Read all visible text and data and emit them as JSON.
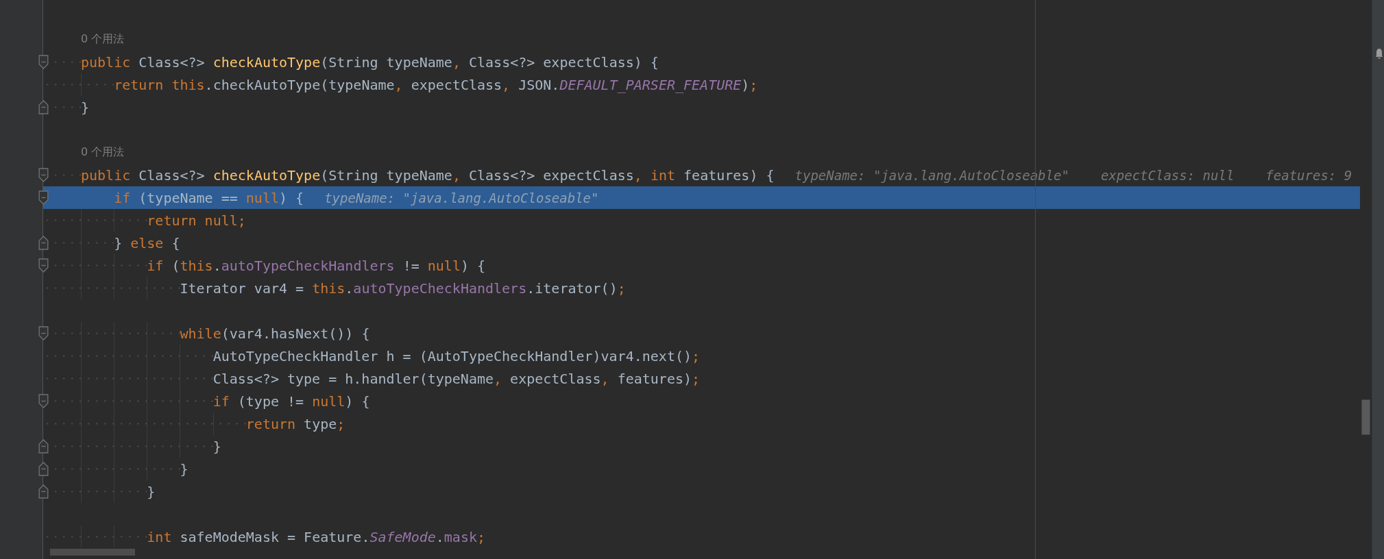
{
  "editor": {
    "lines": [
      {
        "kind": "usage",
        "text": "0 个用法"
      },
      {
        "kind": "code",
        "fold_start": true,
        "selected": false,
        "tokens": [
          {
            "text": "public",
            "kind": "kw"
          },
          {
            "text": " Class<?> ",
            "kind": "plain"
          },
          {
            "text": "checkAutoType",
            "kind": "decl"
          },
          {
            "text": "(String typeName",
            "kind": "plain"
          },
          {
            "text": ",",
            "kind": "punct"
          },
          {
            "text": " Class<?> expectClass) {",
            "kind": "plain"
          }
        ],
        "children": [
          {
            "kind": "code",
            "selected": false,
            "tokens": [
              {
                "text": "return this",
                "kind": "kw"
              },
              {
                "text": ".checkAutoType(typeName",
                "kind": "plain"
              },
              {
                "text": ",",
                "kind": "punct"
              },
              {
                "text": " expectClass",
                "kind": "plain"
              },
              {
                "text": ",",
                "kind": "punct"
              },
              {
                "text": " JSON.",
                "kind": "plain"
              },
              {
                "text": "DEFAULT_PARSER_FEATURE",
                "kind": "static"
              },
              {
                "text": ")",
                "kind": "plain"
              },
              {
                "text": ";",
                "kind": "punct"
              }
            ]
          }
        ]
      },
      {
        "kind": "code",
        "fold_end": true,
        "selected": false,
        "tokens": [
          {
            "text": "}",
            "kind": "plain"
          }
        ]
      },
      {
        "kind": "blank"
      },
      {
        "kind": "usage",
        "text": "0 个用法"
      },
      {
        "kind": "code",
        "fold_start": true,
        "selected": false,
        "tokens": [
          {
            "text": "public",
            "kind": "kw"
          },
          {
            "text": " Class<?> ",
            "kind": "plain"
          },
          {
            "text": "checkAutoType",
            "kind": "decl"
          },
          {
            "text": "(String typeName",
            "kind": "plain"
          },
          {
            "text": ",",
            "kind": "punct"
          },
          {
            "text": " Class<?> expectClass",
            "kind": "plain"
          },
          {
            "text": ",",
            "kind": "punct"
          },
          {
            "text": " int",
            "kind": "kw"
          },
          {
            "text": " features) {",
            "kind": "plain"
          }
        ],
        "hints": [
          "typeName: \"java.lang.AutoCloseable\"",
          "expectClass: null",
          "features: 9"
        ],
        "children": [
          {
            "kind": "code",
            "fold_start": true,
            "selected": true,
            "tokens": [
              {
                "text": "if",
                "kind": "kw"
              },
              {
                "text": " (typeName == ",
                "kind": "plain"
              },
              {
                "text": "null",
                "kind": "kw"
              },
              {
                "text": ") {",
                "kind": "plain"
              }
            ],
            "hints": [
              "typeName: \"java.lang.AutoCloseable\""
            ],
            "children": [
              {
                "kind": "code",
                "selected": false,
                "tokens": [
                  {
                    "text": "return null",
                    "kind": "kw"
                  },
                  {
                    "text": ";",
                    "kind": "punct"
                  }
                ]
              }
            ]
          },
          {
            "kind": "code",
            "fold_end": true,
            "selected": false,
            "tokens": [
              {
                "text": "} ",
                "kind": "plain"
              },
              {
                "text": "else",
                "kind": "kw"
              },
              {
                "text": " {",
                "kind": "plain"
              }
            ],
            "children": [
              {
                "kind": "code",
                "fold_start": true,
                "selected": false,
                "tokens": [
                  {
                    "text": "if",
                    "kind": "kw"
                  },
                  {
                    "text": " (",
                    "kind": "plain"
                  },
                  {
                    "text": "this",
                    "kind": "kw"
                  },
                  {
                    "text": ".",
                    "kind": "plain"
                  },
                  {
                    "text": "autoTypeCheckHandlers",
                    "kind": "field"
                  },
                  {
                    "text": " != ",
                    "kind": "plain"
                  },
                  {
                    "text": "null",
                    "kind": "kw"
                  },
                  {
                    "text": ") {",
                    "kind": "plain"
                  }
                ],
                "children": [
                  {
                    "kind": "code",
                    "selected": false,
                    "tokens": [
                      {
                        "text": "Iterator var4 = ",
                        "kind": "plain"
                      },
                      {
                        "text": "this",
                        "kind": "kw"
                      },
                      {
                        "text": ".",
                        "kind": "plain"
                      },
                      {
                        "text": "autoTypeCheckHandlers",
                        "kind": "field"
                      },
                      {
                        "text": ".iterator()",
                        "kind": "plain"
                      },
                      {
                        "text": ";",
                        "kind": "punct"
                      }
                    ]
                  },
                  {
                    "kind": "blank"
                  },
                  {
                    "kind": "code",
                    "fold_start": true,
                    "selected": false,
                    "tokens": [
                      {
                        "text": "while",
                        "kind": "kw"
                      },
                      {
                        "text": "(var4.hasNext()) {",
                        "kind": "plain"
                      }
                    ],
                    "children": [
                      {
                        "kind": "code",
                        "selected": false,
                        "tokens": [
                          {
                            "text": "AutoTypeCheckHandler h = (AutoTypeCheckHandler)var4.next()",
                            "kind": "plain"
                          },
                          {
                            "text": ";",
                            "kind": "punct"
                          }
                        ]
                      },
                      {
                        "kind": "code",
                        "selected": false,
                        "tokens": [
                          {
                            "text": "Class<?> type = h.handler(typeName",
                            "kind": "plain"
                          },
                          {
                            "text": ",",
                            "kind": "punct"
                          },
                          {
                            "text": " expectClass",
                            "kind": "plain"
                          },
                          {
                            "text": ",",
                            "kind": "punct"
                          },
                          {
                            "text": " features)",
                            "kind": "plain"
                          },
                          {
                            "text": ";",
                            "kind": "punct"
                          }
                        ]
                      },
                      {
                        "kind": "code",
                        "fold_start": true,
                        "selected": false,
                        "tokens": [
                          {
                            "text": "if",
                            "kind": "kw"
                          },
                          {
                            "text": " (type != ",
                            "kind": "plain"
                          },
                          {
                            "text": "null",
                            "kind": "kw"
                          },
                          {
                            "text": ") {",
                            "kind": "plain"
                          }
                        ],
                        "children": [
                          {
                            "kind": "code",
                            "selected": false,
                            "tokens": [
                              {
                                "text": "return",
                                "kind": "kw"
                              },
                              {
                                "text": " type",
                                "kind": "plain"
                              },
                              {
                                "text": ";",
                                "kind": "punct"
                              }
                            ]
                          }
                        ]
                      },
                      {
                        "kind": "code",
                        "fold_end": true,
                        "selected": false,
                        "tokens": [
                          {
                            "text": "}",
                            "kind": "plain"
                          }
                        ]
                      }
                    ]
                  },
                  {
                    "kind": "code",
                    "fold_end": true,
                    "selected": false,
                    "tokens": [
                      {
                        "text": "}",
                        "kind": "plain"
                      }
                    ]
                  }
                ]
              },
              {
                "kind": "code",
                "fold_end": true,
                "selected": false,
                "tokens": [
                  {
                    "text": "}",
                    "kind": "plain"
                  }
                ]
              },
              {
                "kind": "blank"
              },
              {
                "kind": "code",
                "selected": false,
                "tokens": [
                  {
                    "text": "int",
                    "kind": "kw"
                  },
                  {
                    "text": " safeModeMask = Feature.",
                    "kind": "plain"
                  },
                  {
                    "text": "SafeMode",
                    "kind": "static"
                  },
                  {
                    "text": ".",
                    "kind": "plain"
                  },
                  {
                    "text": "mask",
                    "kind": "field"
                  },
                  {
                    "text": ";",
                    "kind": "punct"
                  }
                ]
              }
            ]
          }
        ]
      }
    ]
  }
}
